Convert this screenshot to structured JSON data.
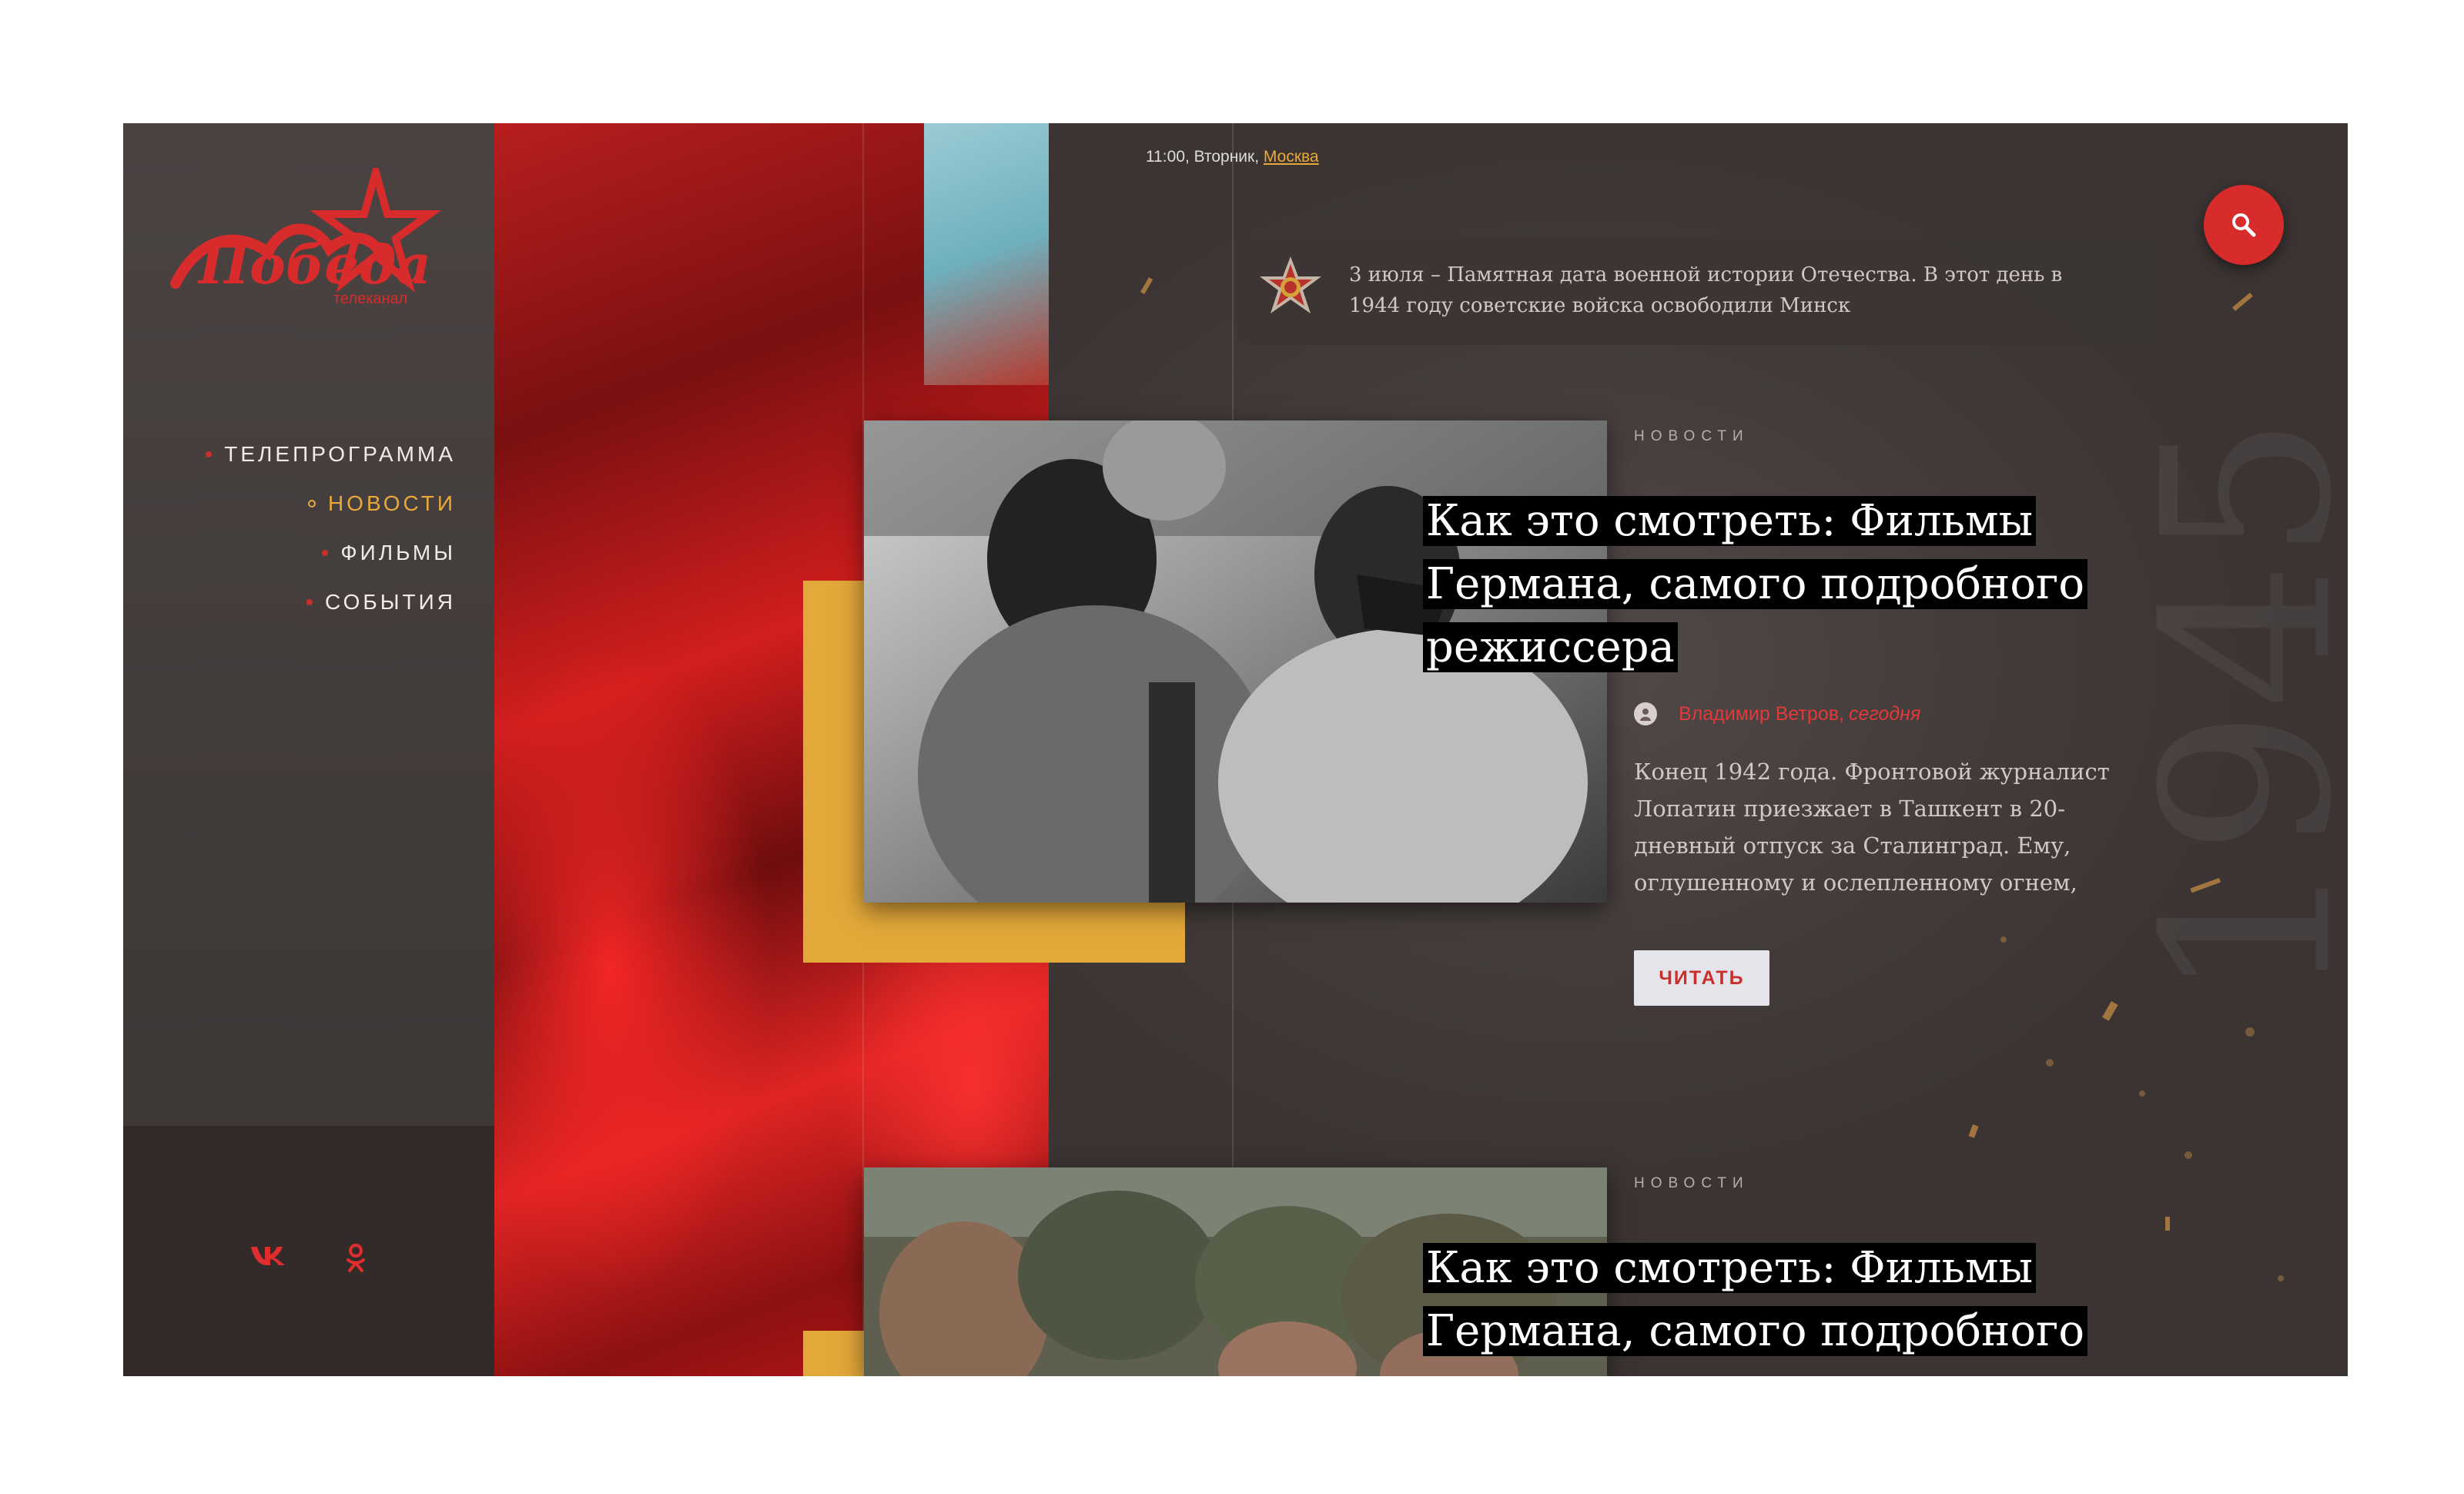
{
  "brand": {
    "logo_text": "Победа",
    "logo_sub": "телеканал",
    "accent": "#d82b2b",
    "highlight": "#e8a93a"
  },
  "nav": {
    "items": [
      {
        "label": "ТЕЛЕПРОГРАММА"
      },
      {
        "label": "НОВОСТИ",
        "active": true
      },
      {
        "label": "ФИЛЬМЫ"
      },
      {
        "label": "СОБЫТИЯ"
      }
    ]
  },
  "social": {
    "vk_icon": "vk-icon",
    "ok_icon": "odnoklassniki-icon"
  },
  "header": {
    "time": "11:00, Вторник, ",
    "city": "Москва",
    "search_icon": "search-icon"
  },
  "notice": {
    "icon": "order-of-patriotic-war-icon",
    "text": "3 июля – Памятная дата военной истории Отечества. В этот день в 1944 году советские войска освободили Минск"
  },
  "news": [
    {
      "category": "НОВОСТИ",
      "title": "Как это смотреть: Фильмы Германа, самого подробного режиссера",
      "author": "Владимир Ветров,",
      "when": "сегодня",
      "excerpt": "Конец 1942 года. Фронтовой журналист Лопатин приезжает в Ташкент в 20-дневный отпуск за Сталинград. Ему, оглушенному и ослепленному огнем,",
      "read_label": "ЧИТАТЬ"
    },
    {
      "category": "НОВОСТИ",
      "title": "Как это смотреть: Фильмы Германа, самого подробного"
    }
  ]
}
